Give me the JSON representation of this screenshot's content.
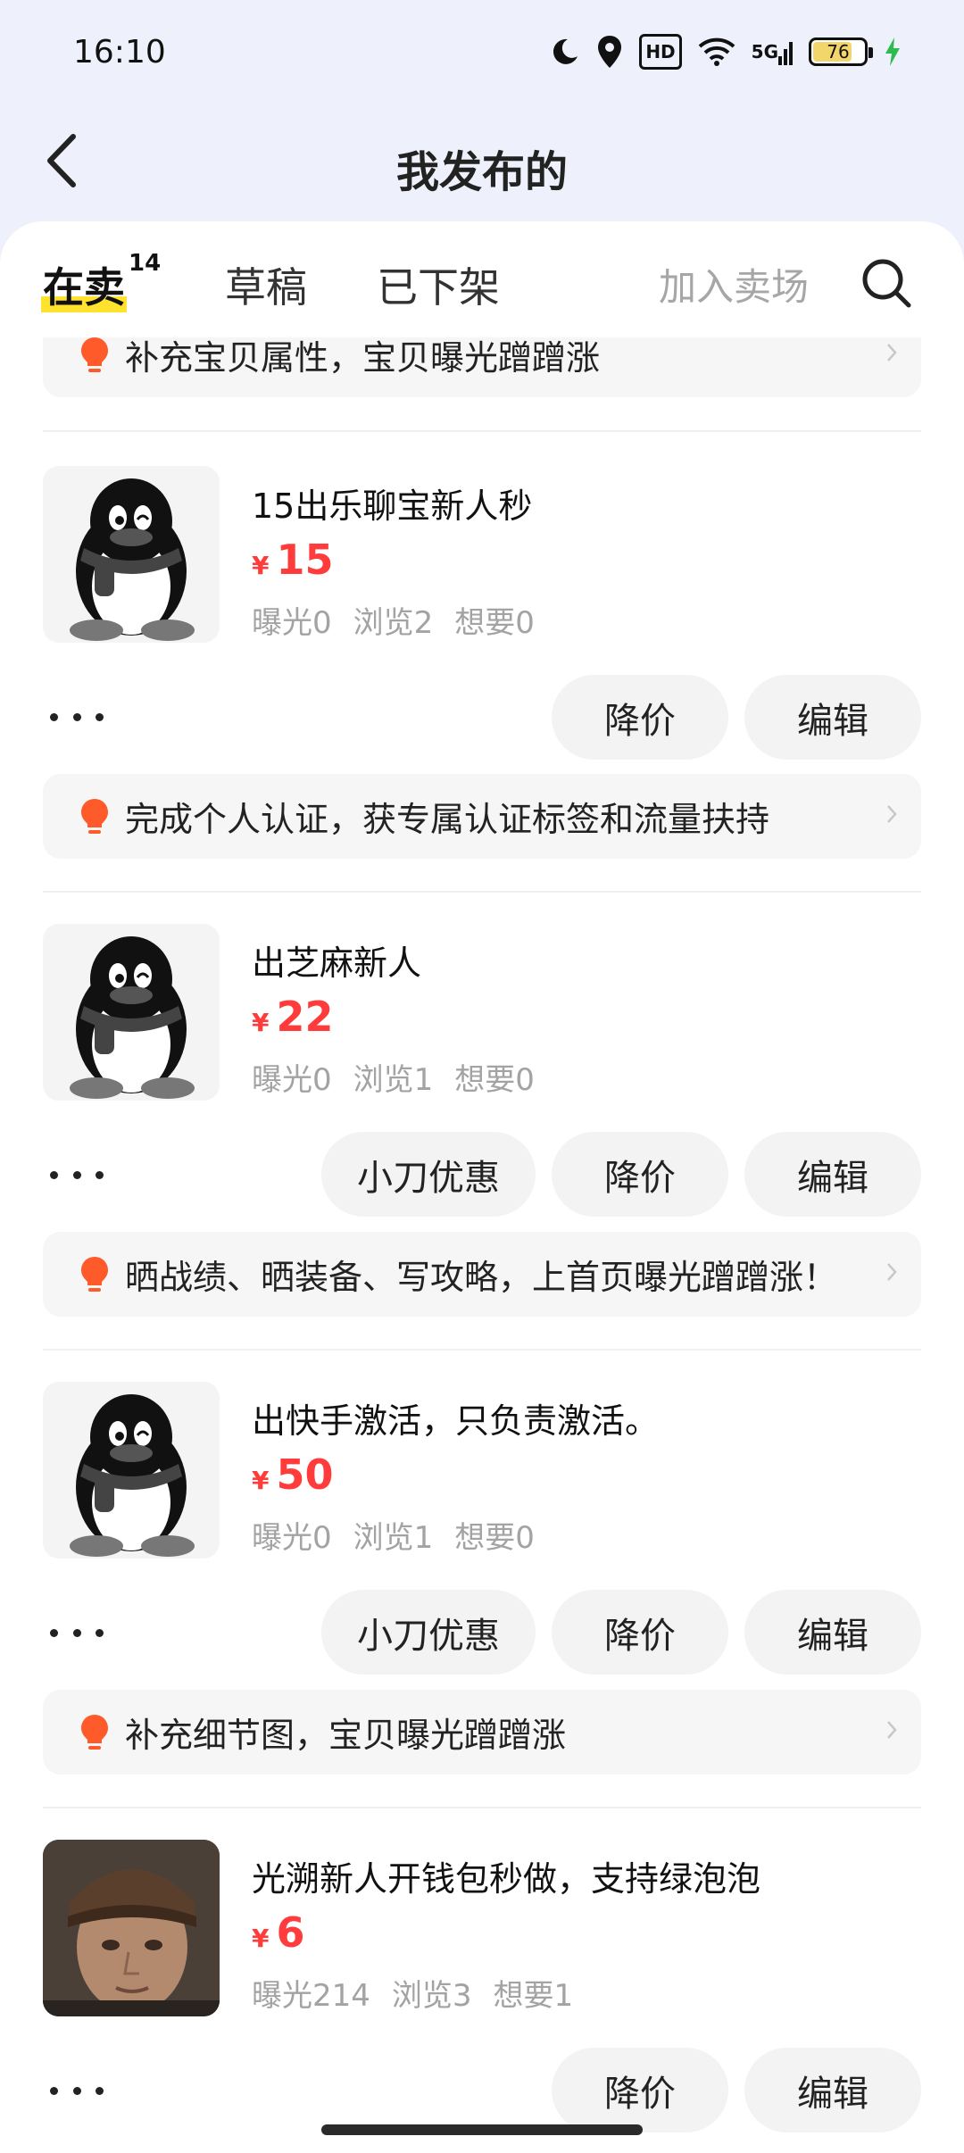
{
  "status_bar": {
    "time": "16:10",
    "hd_label": "HD",
    "signal_label": "5G",
    "battery": "76"
  },
  "header": {
    "title": "我发布的"
  },
  "tabs": {
    "on_sale": "在卖",
    "on_sale_count": "14",
    "drafts": "草稿",
    "removed": "已下架",
    "join_market": "加入卖场"
  },
  "top_tip": "补充宝贝属性，宝贝曝光蹭蹭涨",
  "currency": "¥",
  "buttons": {
    "edit": "编辑",
    "reduce_price": "降价",
    "knife_discount": "小刀优惠"
  },
  "items": [
    {
      "title": "15出乐聊宝新人秒",
      "price": "15",
      "stats": [
        "曝光0",
        "浏览2",
        "想要0"
      ],
      "tip": "完成个人认证，获专属认证标签和流量扶持"
    },
    {
      "title": "出芝麻新人",
      "price": "22",
      "stats": [
        "曝光0",
        "浏览1",
        "想要0"
      ],
      "tip": "晒战绩、晒装备、写攻略，上首页曝光蹭蹭涨！"
    },
    {
      "title": "出快手激活，只负责激活。",
      "price": "50",
      "stats": [
        "曝光0",
        "浏览1",
        "想要0"
      ],
      "tip": "补充细节图，宝贝曝光蹭蹭涨"
    },
    {
      "title": "光溯新人开钱包秒做，支持绿泡泡",
      "price": "6",
      "stats": [
        "曝光214",
        "浏览3",
        "想要1"
      ]
    }
  ],
  "colors": {
    "price": "#ff3b3b",
    "tab_highlight": "#ffe22e",
    "tip_icon": "#ff5a2a"
  }
}
